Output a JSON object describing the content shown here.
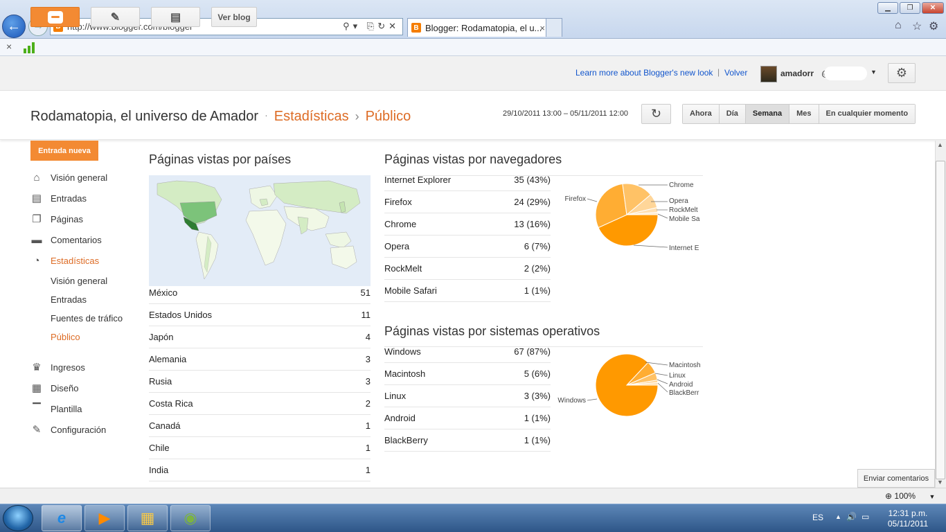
{
  "browser": {
    "address": "http://www.blogger.com/blogger",
    "tab_title": "Blogger: Rodamatopia, el u...",
    "tab_close": "×",
    "cmd_close": "×"
  },
  "header": {
    "ver_blog": "Ver blog",
    "learn_more": "Learn more about Blogger's new look",
    "separator": "|",
    "volver": "Volver",
    "user": "amadorr",
    "user_at": "@"
  },
  "title": {
    "blog_name": "Rodamatopia, el universo de Amador",
    "sep1": "·",
    "crumb1": "Estadísticas",
    "sep2": "›",
    "crumb2": "Público",
    "date_range": "29/10/2011 13:00 – 05/11/2011 12:00"
  },
  "periods": [
    "Ahora",
    "Día",
    "Semana",
    "Mes",
    "En cualquier momento"
  ],
  "active_period": "Semana",
  "sidebar": {
    "new_post": "Entrada nueva",
    "items": [
      {
        "label": "Visión general",
        "icon": "home-icon"
      },
      {
        "label": "Entradas",
        "icon": "posts-icon"
      },
      {
        "label": "Páginas",
        "icon": "pages-icon"
      },
      {
        "label": "Comentarios",
        "icon": "comment-icon"
      },
      {
        "label": "Estadísticas",
        "icon": "stats-pie-icon"
      }
    ],
    "sub_items": [
      "Visión general",
      "Entradas",
      "Fuentes de tráfico",
      "Público"
    ],
    "items2": [
      {
        "label": "Ingresos",
        "icon": "trophy-icon"
      },
      {
        "label": "Diseño",
        "icon": "layout-icon"
      },
      {
        "label": "Plantilla",
        "icon": "paint-roller-icon"
      },
      {
        "label": "Configuración",
        "icon": "wrench-icon"
      }
    ]
  },
  "countries": {
    "title": "Páginas vistas por países",
    "rows": [
      {
        "name": "México",
        "value": "51"
      },
      {
        "name": "Estados Unidos",
        "value": "11"
      },
      {
        "name": "Japón",
        "value": "4"
      },
      {
        "name": "Alemania",
        "value": "3"
      },
      {
        "name": "Rusia",
        "value": "3"
      },
      {
        "name": "Costa Rica",
        "value": "2"
      },
      {
        "name": "Canadá",
        "value": "1"
      },
      {
        "name": "Chile",
        "value": "1"
      },
      {
        "name": "India",
        "value": "1"
      }
    ]
  },
  "browsers": {
    "title": "Páginas vistas por navegadores",
    "rows": [
      {
        "name": "Internet Explorer",
        "value": "35 (43%)"
      },
      {
        "name": "Firefox",
        "value": "24 (29%)"
      },
      {
        "name": "Chrome",
        "value": "13 (16%)"
      },
      {
        "name": "Opera",
        "value": "6 (7%)"
      },
      {
        "name": "RockMelt",
        "value": "2 (2%)"
      },
      {
        "name": "Mobile Safari",
        "value": "1 (1%)"
      }
    ],
    "pie_labels": [
      "Chrome",
      "Opera",
      "RockMelt",
      "Mobile Sa",
      "Internet E",
      "Firefox"
    ]
  },
  "oses": {
    "title": "Páginas vistas por sistemas operativos",
    "rows": [
      {
        "name": "Windows",
        "value": "67 (87%)"
      },
      {
        "name": "Macintosh",
        "value": "5 (6%)"
      },
      {
        "name": "Linux",
        "value": "3 (3%)"
      },
      {
        "name": "Android",
        "value": "1 (1%)"
      },
      {
        "name": "BlackBerry",
        "value": "1 (1%)"
      }
    ],
    "pie_labels": [
      "Macintosh",
      "Linux",
      "Android",
      "BlackBerr",
      "Windows"
    ]
  },
  "chart_data": [
    {
      "type": "pie",
      "categories": [
        "Internet Explorer",
        "Firefox",
        "Chrome",
        "Opera",
        "RockMelt",
        "Mobile Safari"
      ],
      "values": [
        35,
        24,
        13,
        6,
        2,
        1
      ]
    },
    {
      "type": "pie",
      "categories": [
        "Windows",
        "Macintosh",
        "Linux",
        "Android",
        "BlackBerry"
      ],
      "values": [
        67,
        5,
        3,
        1,
        1
      ]
    }
  ],
  "pie_colors": [
    "#ff9900",
    "#ffad33",
    "#ffc266",
    "#ffd699",
    "#ffe0b3",
    "#ffebcc"
  ],
  "feedback": "Enviar comentarios",
  "zoom": "100%",
  "taskbar": {
    "lang": "ES",
    "time": "12:31 p.m.",
    "date": "05/11/2011"
  },
  "colors": {
    "accent": "#f38a33",
    "link": "#1155cc",
    "breadcrumb": "#dd6b24"
  }
}
